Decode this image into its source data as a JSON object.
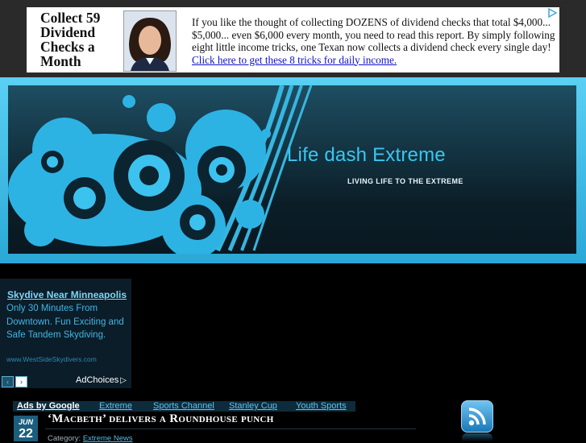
{
  "top_ad": {
    "headline": "Collect 59 Dividend Checks a Month",
    "body": "If you like the thought of  collecting DOZENS of dividend checks that total $4,000... $5,000... even $6,000 every month, you need to read this report. By simply following eight little income tricks, one Texan now collects a dividend check every single day!",
    "link": " Click here to get these 8 tricks for daily income.",
    "adchoices_icon": "adchoices-triangle-icon"
  },
  "header": {
    "site_title": "Life dash Extreme",
    "tagline": "LIVING LIFE TO THE EXTREME",
    "colors": {
      "frame": "#3bbde8",
      "panel": "#0f2b38",
      "accent": "#38c7f2"
    }
  },
  "side_ad": {
    "title": "Skydive Near Minneapolis",
    "text": "Only 30 Minutes From Downtown. Fun Exciting and Safe Tandem Skydiving.",
    "url": "www.WestSideSkydivers.com",
    "prev_icon": "‹",
    "next_icon": "›",
    "adchoices": "AdChoices",
    "adchoices_icon": "▷"
  },
  "link_bar": {
    "ads_by": "Ads by Google",
    "links": [
      "Extreme",
      "Sports Channel",
      "Stanley Cup",
      "Youth Sports"
    ]
  },
  "post": {
    "month": "JUN",
    "day": "22",
    "title": "‘Macbeth’ delivers a Roundhouse punch",
    "category_label": "Category:",
    "category": "Extreme News"
  },
  "rss_icon": "rss-feed-icon"
}
